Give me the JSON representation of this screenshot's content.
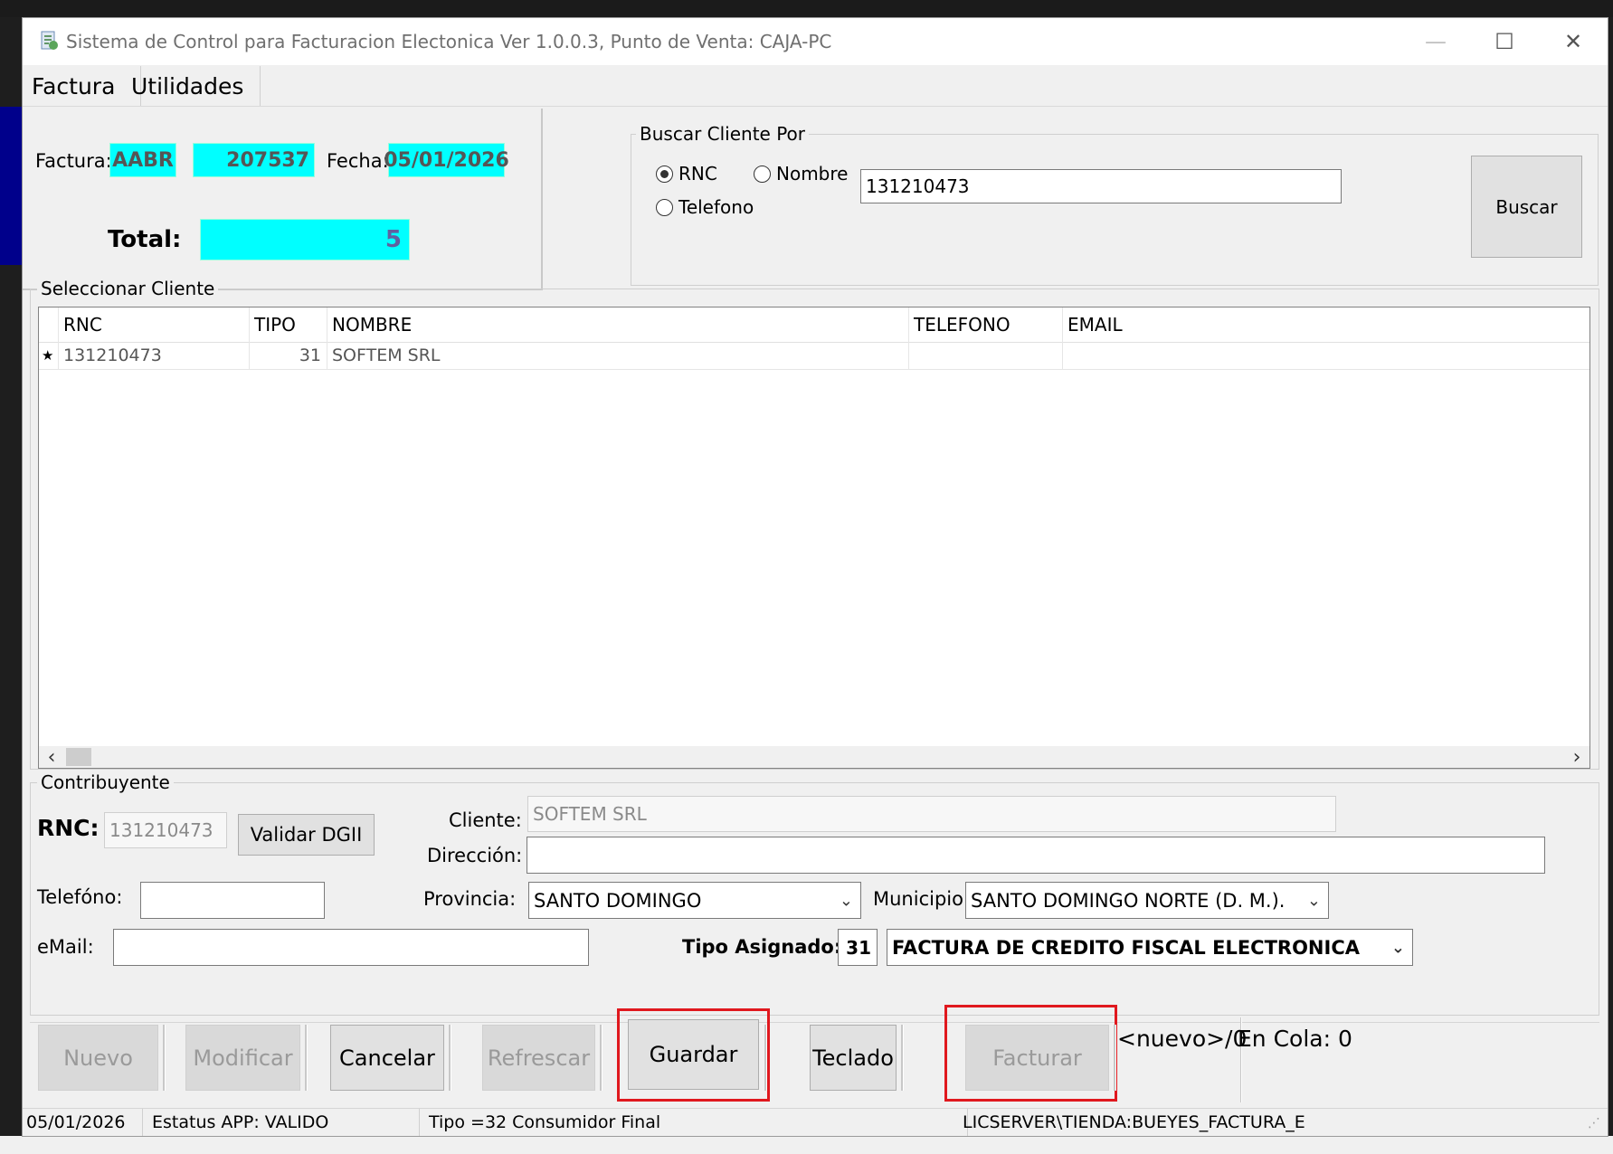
{
  "window": {
    "title": "Sistema de Control para Facturacion Electonica  Ver 1.0.0.3, Punto de Venta: CAJA-PC",
    "controls": {
      "minimize": "—",
      "maximize": "☐",
      "close": "✕"
    }
  },
  "menu": [
    {
      "label": "Factura"
    },
    {
      "label": "Utilidades"
    }
  ],
  "invoice": {
    "factura_label": "Factura:",
    "series": "AABR",
    "number": "207537",
    "fecha_label": "Fecha:",
    "date": "05/01/2026",
    "total_label": "Total:",
    "total": "5"
  },
  "search": {
    "group_title": "Buscar Cliente Por",
    "options": [
      {
        "label": "RNC",
        "selected": true
      },
      {
        "label": "Nombre",
        "selected": false
      },
      {
        "label": "Telefono",
        "selected": false
      }
    ],
    "query": "131210473",
    "button": "Buscar"
  },
  "client_grid": {
    "group_title": "Seleccionar Cliente",
    "columns": [
      "RNC",
      "TIPO",
      "NOMBRE",
      "TELEFONO",
      "EMAIL"
    ],
    "rows": [
      {
        "marker": "★",
        "rnc": "131210473",
        "tipo": "31",
        "nombre": "SOFTEM SRL",
        "telefono": "",
        "email": ""
      }
    ],
    "scroll_left": "‹",
    "scroll_right": "›"
  },
  "contribuyente": {
    "group_title": "Contribuyente",
    "rnc_label": "RNC:",
    "rnc_value": "131210473",
    "validate_button": "Validar DGII",
    "cliente_label": "Cliente:",
    "cliente_value": "SOFTEM SRL",
    "direccion_label": "Dirección:",
    "direccion_value": "",
    "telefono_label": "Telefóno:",
    "telefono_value": "",
    "provincia_label": "Provincia:",
    "provincia_value": "SANTO DOMINGO",
    "municipio_label": "Municipio",
    "municipio_value": "SANTO DOMINGO NORTE (D. M.).",
    "email_label": "eMail:",
    "email_value": "",
    "tipo_label": "Tipo Asignado:",
    "tipo_code": "31",
    "tipo_desc": "FACTURA DE CREDITO FISCAL ELECTRONICA"
  },
  "actions": {
    "nuevo": "Nuevo",
    "modificar": "Modificar",
    "cancelar": "Cancelar",
    "refrescar": "Refrescar",
    "guardar": "Guardar",
    "teclado": "Teclado",
    "facturar": "Facturar",
    "record_status": "<nuevo>/0",
    "queue_status": "En Cola: 0"
  },
  "status_bar": {
    "date": "05/01/2026",
    "app_status": "Estatus APP: VALIDO",
    "tipo": "Tipo =32 Consumidor Final",
    "server": "LICSERVER\\TIENDA:BUEYES_FACTURA_E"
  },
  "colors": {
    "cyan_field": "#00ffff",
    "highlight_red": "#e0181e",
    "desktop_blue": "#00008b"
  }
}
